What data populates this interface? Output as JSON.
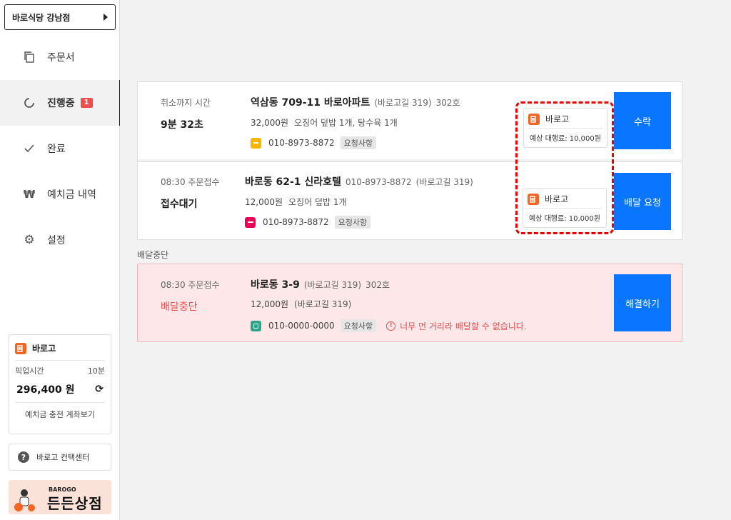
{
  "sidebar": {
    "store_name": "바로식당 강남점",
    "nav": [
      {
        "label": "주문서"
      },
      {
        "label": "진행중",
        "badge": "1"
      },
      {
        "label": "완료"
      },
      {
        "label": "예치금 내역"
      },
      {
        "label": "설정"
      }
    ],
    "wallet": {
      "brand": "바로고",
      "pickup_label": "픽업시간",
      "pickup_value": "10분",
      "balance": "296,400 원",
      "footer": "예치금 충전 계좌보기"
    },
    "support_label": "바로고 컨택센터",
    "banner": {
      "small": "BAROGO",
      "big": "든든상점"
    }
  },
  "orders": [
    {
      "left_label": "취소까지 시간",
      "left_value": "9분 32초",
      "address": "역삼동 709-11 바로아파트",
      "address_road": "(바로고길 319)",
      "address_unit": "302호",
      "price": "32,000원",
      "menu": "오징어 덮밥 1개, 탕수육 1개",
      "phone": "010-8973-8872",
      "request_tag": "요청사항",
      "agency_name": "바로고",
      "agency_fee": "예상 대행료: 10,000원",
      "action": "수락"
    },
    {
      "left_label": "08:30 주문접수",
      "left_value": "접수대기",
      "address": "바로동 62-1 신라호텔",
      "address_phone": "010-8973-8872",
      "address_road": "(바로고길 319)",
      "price": "12,000원",
      "menu": "오징어 덮밥 1개",
      "phone": "010-8973-8872",
      "request_tag": "요청사항",
      "agency_name": "바로고",
      "agency_fee": "예상 대행료: 10,000원",
      "action": "배달 요청"
    }
  ],
  "stopped_section": {
    "title": "배달중단",
    "order": {
      "left_label": "08:30 주문접수",
      "left_value": "배달중단",
      "address": "바로동 3-9",
      "address_road": "(바로고길 319)",
      "address_unit": "302호",
      "price": "12,000원",
      "menu": "(바로고길 319)",
      "phone": "010-0000-0000",
      "request_tag": "요청사항",
      "warning": "너무 먼 거리라 배달할 수 없습니다.",
      "action": "해결하기"
    }
  },
  "colors": {
    "accent": "#0a76ff",
    "danger": "#f04e4e",
    "brand": "#f26522"
  }
}
